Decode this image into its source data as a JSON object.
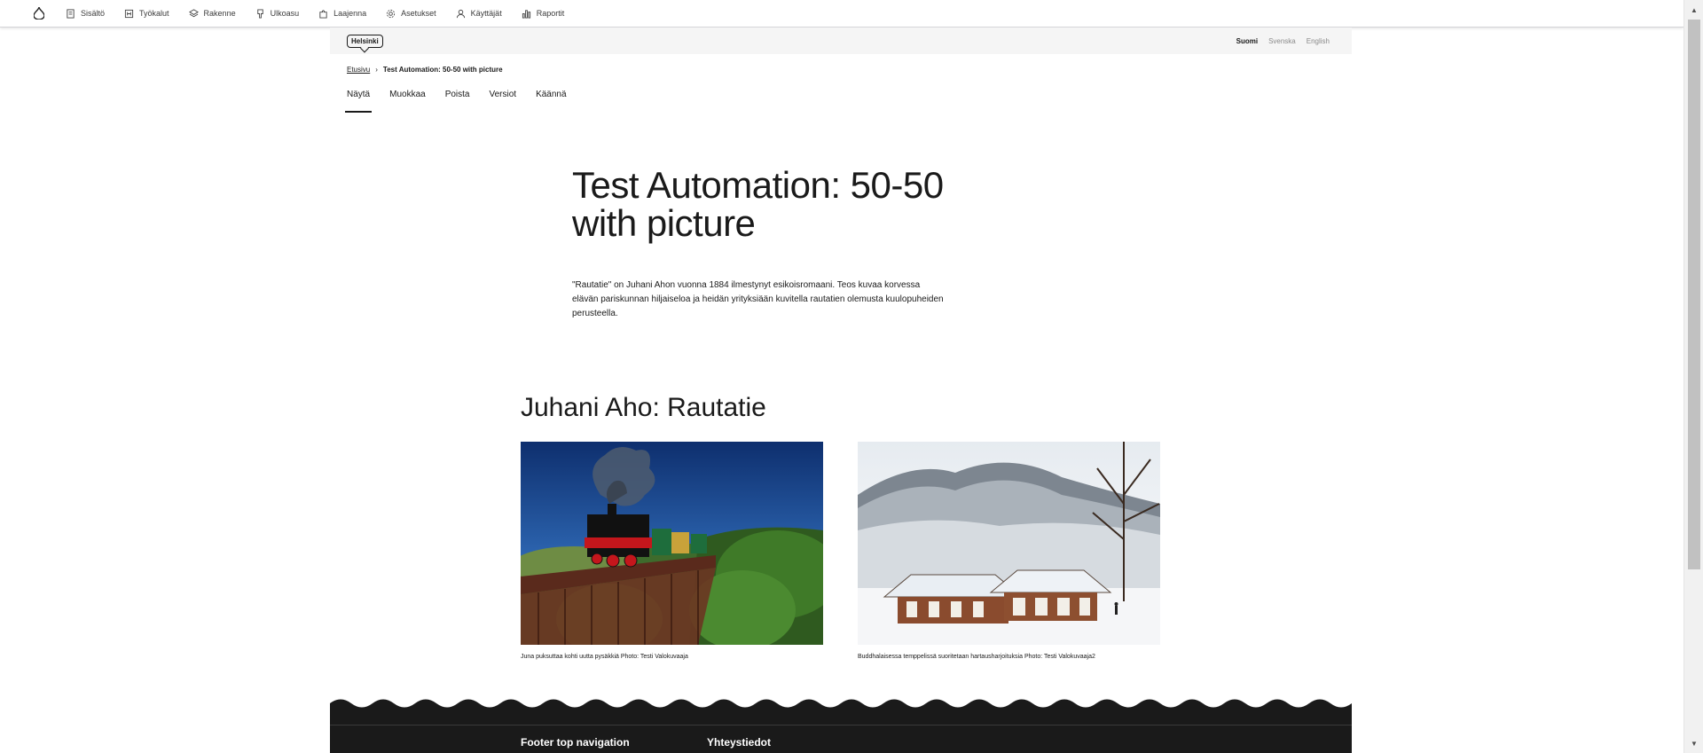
{
  "admin_toolbar": {
    "items": [
      {
        "label": "Sisältö",
        "icon": "file-icon"
      },
      {
        "label": "Työkalut",
        "icon": "tools-icon"
      },
      {
        "label": "Rakenne",
        "icon": "layers-icon"
      },
      {
        "label": "Ulkoasu",
        "icon": "brush-icon"
      },
      {
        "label": "Laajenna",
        "icon": "puzzle-icon"
      },
      {
        "label": "Asetukset",
        "icon": "gear-icon"
      },
      {
        "label": "Käyttäjät",
        "icon": "user-icon"
      },
      {
        "label": "Raportit",
        "icon": "chart-icon"
      }
    ]
  },
  "site_header": {
    "logo": "Helsinki",
    "languages": [
      {
        "label": "Suomi",
        "active": true
      },
      {
        "label": "Svenska",
        "active": false
      },
      {
        "label": "English",
        "active": false
      }
    ]
  },
  "breadcrumb": {
    "home": "Etusivu",
    "separator": "›",
    "current": "Test Automation: 50-50 with picture"
  },
  "tabs": [
    {
      "label": "Näytä",
      "active": true
    },
    {
      "label": "Muokkaa",
      "active": false
    },
    {
      "label": "Poista",
      "active": false
    },
    {
      "label": "Versiot",
      "active": false
    },
    {
      "label": "Käännä",
      "active": false
    }
  ],
  "hero": {
    "title": "Test Automation: 50-50 with picture",
    "lead": "\"Rautatie\" on Juhani Ahon vuonna 1884 ilmestynyt esikoisromaani. Teos kuvaa korvessa elävän pariskunnan hiljaiseloa ja heidän yrityksiään kuvitella rautatien olemusta kuulopuheiden perusteella."
  },
  "section": {
    "heading": "Juhani Aho: Rautatie",
    "figures": [
      {
        "caption": "Juna puksuttaa kohti uutta pysäkkiä Photo: Testi Valokuvaaja"
      },
      {
        "caption": "Buddhalaisessa temppelissä suoritetaan hartausharjoituksia Photo: Testi Valokuvaaja2"
      }
    ]
  },
  "footer": {
    "headings": [
      "Footer top navigation",
      "Yhteystiedot"
    ]
  },
  "colors": {
    "accent": "#1a1a1a",
    "header_bg": "#f5f5f5",
    "footer_bg": "#1a1a1a"
  }
}
